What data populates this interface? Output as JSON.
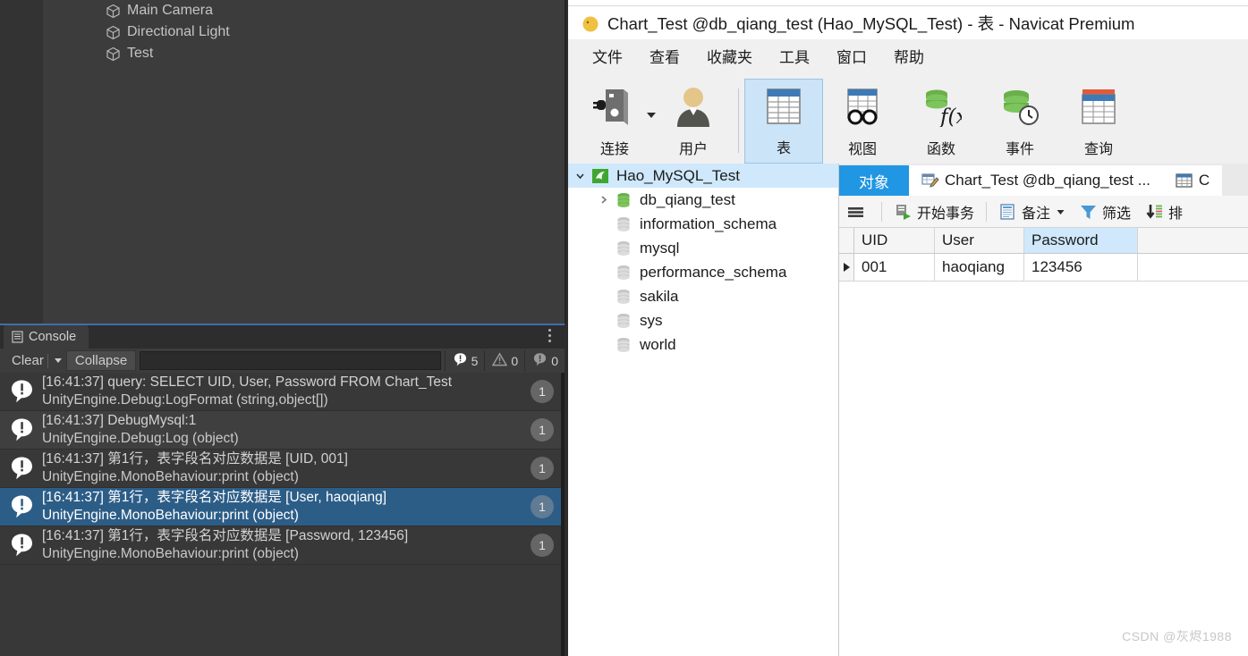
{
  "unity": {
    "hierarchy": {
      "items": [
        {
          "label": "Main Camera",
          "icon": "cube-icon"
        },
        {
          "label": "Directional Light",
          "icon": "cube-icon"
        },
        {
          "label": "Test",
          "icon": "cube-icon"
        }
      ]
    },
    "console": {
      "tab_label": "Console",
      "tab_icon": "console-icon",
      "menu_icon": "kebab-menu-icon",
      "clear_label": "Clear",
      "clear_dropdown_icon": "chevron-down-icon",
      "collapse_label": "Collapse",
      "search_value": "",
      "counters": {
        "info_icon": "info-badge-icon",
        "info_count": "5",
        "warning_icon": "warning-triangle-icon",
        "warning_count": "0",
        "error_icon": "error-circle-icon",
        "error_count": "0"
      },
      "logs": [
        {
          "line1": "[16:41:37] query: SELECT UID, User, Password FROM Chart_Test",
          "line2": "UnityEngine.Debug:LogFormat (string,object[])",
          "count": "1",
          "selected": false
        },
        {
          "line1": "[16:41:37] DebugMysql:1",
          "line2": "UnityEngine.Debug:Log (object)",
          "count": "1",
          "selected": false
        },
        {
          "line1": "[16:41:37] 第1行，表字段名对应数据是 [UID, 001]",
          "line2": "UnityEngine.MonoBehaviour:print (object)",
          "count": "1",
          "selected": false
        },
        {
          "line1": "[16:41:37] 第1行，表字段名对应数据是 [User, haoqiang]",
          "line2": "UnityEngine.MonoBehaviour:print (object)",
          "count": "1",
          "selected": true
        },
        {
          "line1": "[16:41:37] 第1行，表字段名对应数据是 [Password, 123456]",
          "line2": "UnityEngine.MonoBehaviour:print (object)",
          "count": "1",
          "selected": false
        }
      ]
    }
  },
  "navicat": {
    "title": "Chart_Test @db_qiang_test (Hao_MySQL_Test) - 表 - Navicat Premium",
    "logo_icon": "navicat-logo-icon",
    "menus": [
      "文件",
      "查看",
      "收藏夹",
      "工具",
      "窗口",
      "帮助"
    ],
    "toolbar": [
      {
        "label": "连接",
        "icon": "connection-icon",
        "active": false,
        "dropdown": true
      },
      {
        "label": "用户",
        "icon": "user-icon",
        "active": false,
        "dropdown": false
      },
      {
        "label": "表",
        "icon": "table-icon",
        "active": true,
        "dropdown": false
      },
      {
        "label": "视图",
        "icon": "view-icon",
        "active": false,
        "dropdown": false
      },
      {
        "label": "函数",
        "icon": "function-icon",
        "active": false,
        "dropdown": false
      },
      {
        "label": "事件",
        "icon": "event-icon",
        "active": false,
        "dropdown": false
      },
      {
        "label": "查询",
        "icon": "query-icon",
        "active": false,
        "dropdown": false
      }
    ],
    "tree": [
      {
        "label": "Hao_MySQL_Test",
        "icon": "mysql-connection-icon",
        "indent": 0,
        "arrow": "expanded",
        "selected": true
      },
      {
        "label": "db_qiang_test",
        "icon": "database-open-icon",
        "indent": 1,
        "arrow": "collapsed",
        "selected": false
      },
      {
        "label": "information_schema",
        "icon": "database-icon",
        "indent": 1,
        "arrow": "none",
        "selected": false
      },
      {
        "label": "mysql",
        "icon": "database-icon",
        "indent": 1,
        "arrow": "none",
        "selected": false
      },
      {
        "label": "performance_schema",
        "icon": "database-icon",
        "indent": 1,
        "arrow": "none",
        "selected": false
      },
      {
        "label": "sakila",
        "icon": "database-icon",
        "indent": 1,
        "arrow": "none",
        "selected": false
      },
      {
        "label": "sys",
        "icon": "database-icon",
        "indent": 1,
        "arrow": "none",
        "selected": false
      },
      {
        "label": "world",
        "icon": "database-icon",
        "indent": 1,
        "arrow": "none",
        "selected": false
      }
    ],
    "tabs": [
      {
        "label": "对象",
        "icon": "none",
        "active": true
      },
      {
        "label": "Chart_Test @db_qiang_test ...",
        "icon": "table-designer-icon",
        "active": false
      },
      {
        "label": "C",
        "icon": "grid-icon",
        "active": false
      }
    ],
    "gridbar": [
      {
        "label": "",
        "icon": "hamburger-icon"
      },
      {
        "label": "开始事务",
        "icon": "begin-transaction-icon"
      },
      {
        "label": "备注",
        "icon": "note-icon",
        "dropdown": true
      },
      {
        "label": "筛选",
        "icon": "filter-icon"
      },
      {
        "label": "排",
        "icon": "sort-icon"
      }
    ],
    "grid": {
      "columns": [
        "UID",
        "User",
        "Password"
      ],
      "highlighted_column": "Password",
      "rows": [
        {
          "UID": "001",
          "User": "haoqiang",
          "Password": "123456",
          "current": true
        }
      ]
    }
  },
  "watermark": "CSDN @灰烬1988",
  "colors": {
    "unity_bg": "#3c3c3c",
    "console_bg": "#383838",
    "selection_blue": "#2c5d87",
    "navicat_accent": "#2196e3",
    "tree_select": "#cfe8fb",
    "toolbar_active": "#cce4f7"
  }
}
